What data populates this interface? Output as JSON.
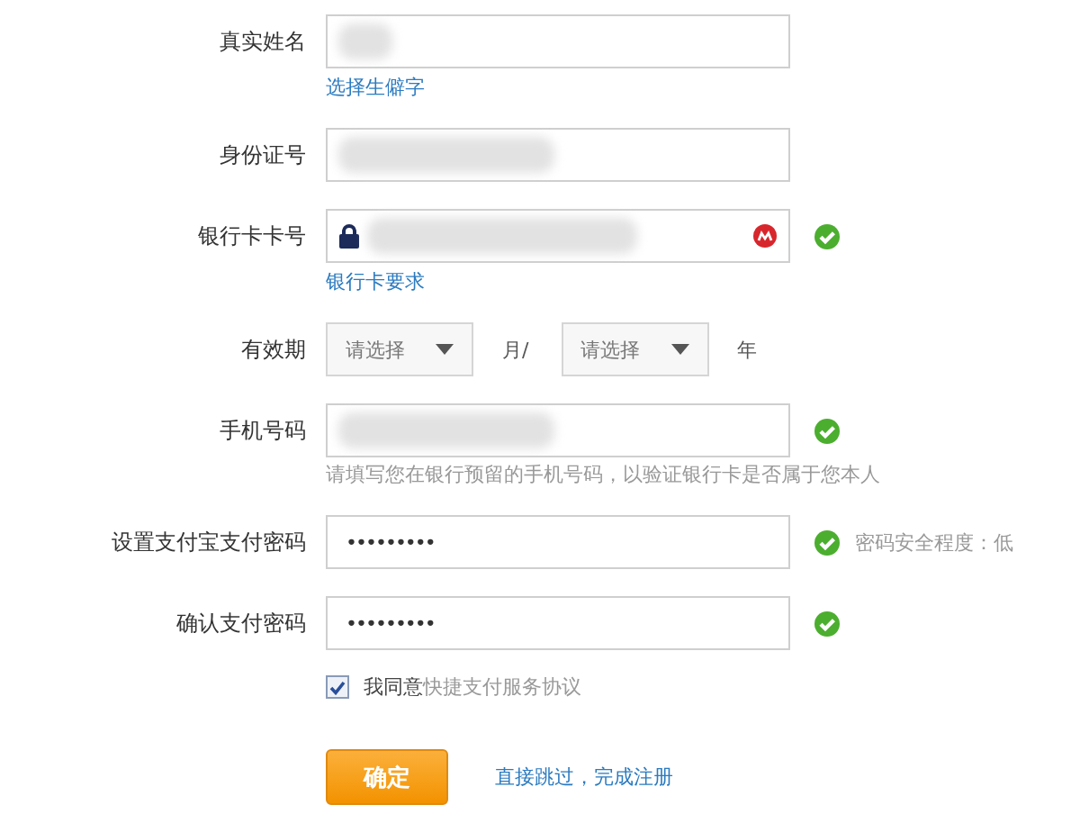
{
  "fields": [
    {
      "kind": "text",
      "label": "真实姓名",
      "value_hidden": true,
      "valid": false,
      "link": "选择生僻字"
    },
    {
      "kind": "text",
      "label": "身份证号",
      "value_hidden": true,
      "valid": false
    },
    {
      "kind": "card",
      "label": "银行卡卡号",
      "value_hidden": true,
      "valid": true,
      "link": "银行卡要求"
    },
    {
      "kind": "expiry",
      "label": "有效期",
      "month": "请选择",
      "month_unit": "月/",
      "year": "请选择",
      "year_unit": "年"
    },
    {
      "kind": "text",
      "label": "手机号码",
      "value_hidden": true,
      "valid": true,
      "note": "请填写您在银行预留的手机号码，以验证银行卡是否属于您本人"
    },
    {
      "kind": "password",
      "label": "设置支付宝支付密码",
      "value": "•••••••••",
      "valid": true,
      "status": "密码安全程度：低"
    },
    {
      "kind": "password",
      "label": "确认支付密码",
      "value": "•••••••••",
      "valid": true
    }
  ],
  "agreement": {
    "checked": true,
    "label": "我同意",
    "document": "快捷支付服务协议"
  },
  "submit": "确定",
  "skip_link": "直接跳过，完成注册"
}
